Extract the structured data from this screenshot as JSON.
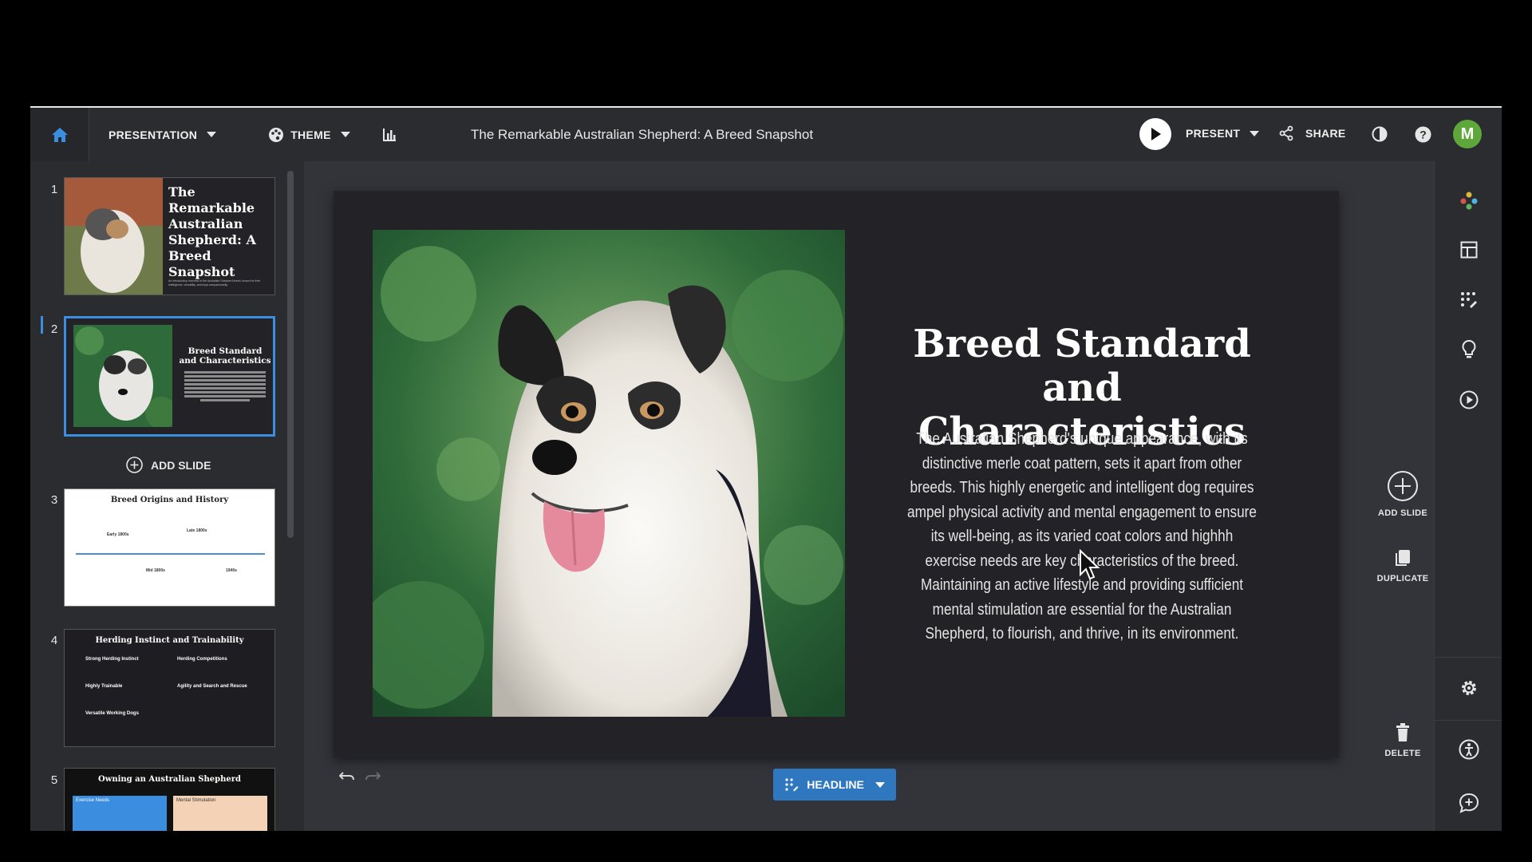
{
  "topbar": {
    "presentation_label": "PRESENTATION",
    "theme_label": "THEME",
    "document_title": "The Remarkable Australian Shepherd: A Breed Snapshot",
    "present_label": "PRESENT",
    "share_label": "SHARE",
    "avatar_initial": "M"
  },
  "sidebar": {
    "add_slide_label": "ADD SLIDE",
    "slides": [
      {
        "number": "1",
        "title": "The Remarkable Australian Shepherd: A Breed Snapshot",
        "subtitle": "An introductory overview of the Australian Shepherd breed, known for their intelligence, versatility, and loyal companionship."
      },
      {
        "number": "2",
        "title": "Breed Standard and Characteristics"
      },
      {
        "number": "3",
        "title": "Breed Origins and History",
        "timeline": [
          "Early 1800s",
          "Late 1800s",
          "Mid 1800s",
          "1940s"
        ]
      },
      {
        "number": "4",
        "title": "Herding Instinct and Trainability",
        "bullets_left": [
          "Strong Herding Instinct",
          "Highly Trainable",
          "Versatile Working Dogs"
        ],
        "bullets_right": [
          "Herding Competitions",
          "Agility and Search and Rescue"
        ]
      },
      {
        "number": "5",
        "title": "Owning an Australian Shepherd",
        "cards": [
          "Exercise Needs",
          "Mental Stimulation"
        ]
      }
    ]
  },
  "slide": {
    "heading": "Breed Standard and Characteristics",
    "body": "The Australian Shepherd's unique appearance, with its distinctive merle coat pattern, sets it apart from other breeds. This highly energetic and intelligent dog requires ampel physical activity and mental engagement to ensure its well-being, as its varied coat colors and highhh exercise needs are key characteristics of the breed. Maintaining an active lifestyle and providing sufficient mental stimulation are essential for the Australian Shepherd, to flourish, and thrive, in its environment."
  },
  "actions": {
    "add_slide_label": "ADD SLIDE",
    "duplicate_label": "DUPLICATE",
    "delete_label": "DELETE"
  },
  "bottom": {
    "headline_label": "HEADLINE"
  },
  "colors": {
    "accent": "#3b8de0",
    "button_blue": "#2f78c0",
    "avatar_green": "#5ea83b",
    "slide_bg": "#232327"
  }
}
